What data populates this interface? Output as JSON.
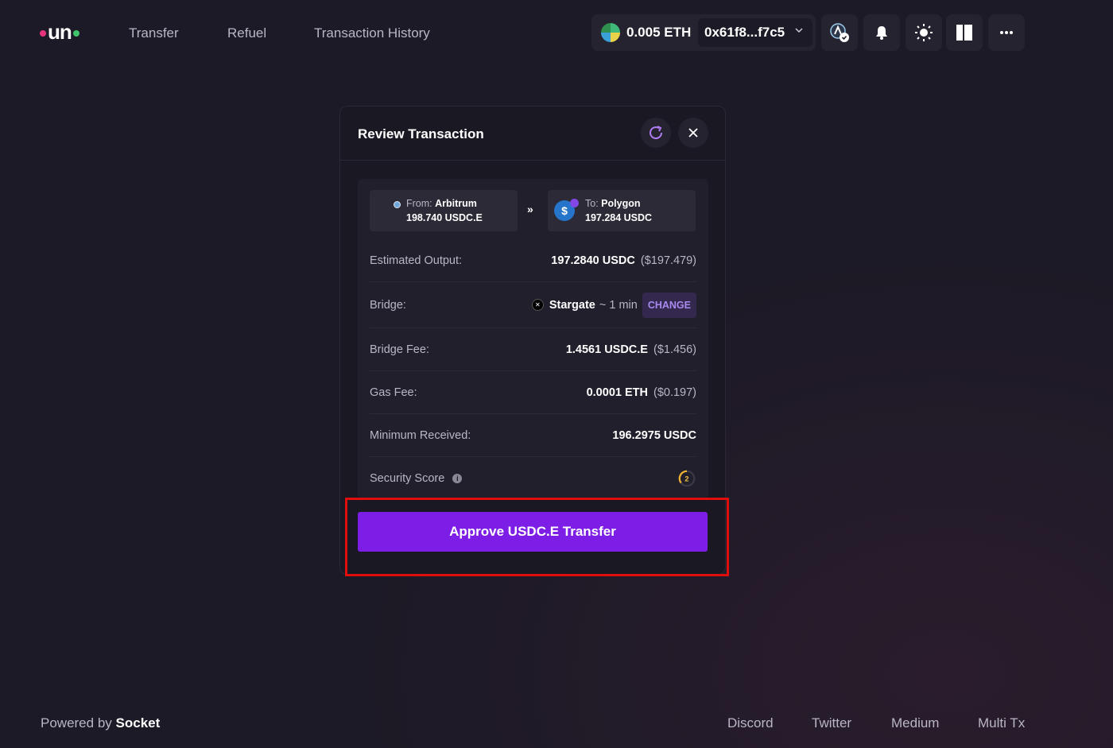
{
  "logo": {
    "text": "un"
  },
  "nav": {
    "transfer": "Transfer",
    "refuel": "Refuel",
    "history": "Transaction History"
  },
  "wallet": {
    "balance": "0.005 ETH",
    "address": "0x61f8...f7c5",
    "token_icon": "eth-token-icon"
  },
  "header_buttons": [
    "chain-selector-icon",
    "bell-icon",
    "sun-icon",
    "layout-icon",
    "more-icon"
  ],
  "modal": {
    "title": "Review Transaction",
    "from": {
      "label": "From:",
      "chain": "Arbitrum",
      "amount": "198.740 USDC.E"
    },
    "to": {
      "label": "To:",
      "chain": "Polygon",
      "amount": "197.284 USDC"
    },
    "arrow": "»",
    "rows": [
      {
        "key": "Estimated Output:",
        "value": "197.2840 USDC",
        "usd": "($197.479)"
      },
      {
        "key": "Bridge:",
        "value": "Stargate",
        "eta": "~ 1 min",
        "action": "CHANGE"
      },
      {
        "key": "Bridge Fee:",
        "value": "1.4561 USDC.E",
        "usd": "($1.456)"
      },
      {
        "key": "Gas Fee:",
        "value": "0.0001 ETH",
        "usd": "($0.197)"
      },
      {
        "key": "Minimum Received:",
        "value": "196.2975 USDC"
      },
      {
        "key": "Security Score",
        "info": "i",
        "score": "2"
      }
    ],
    "approve_button": "Approve USDC.E Transfer"
  },
  "footer": {
    "powered_by": "Powered by",
    "brand": "Socket",
    "links": [
      "Discord",
      "Twitter",
      "Medium",
      "Multi Tx"
    ]
  },
  "colors": {
    "accent": "#7c1ee6",
    "highlight": "#e00d0d",
    "background": "#1c1a26",
    "change_text": "#a88af0"
  }
}
